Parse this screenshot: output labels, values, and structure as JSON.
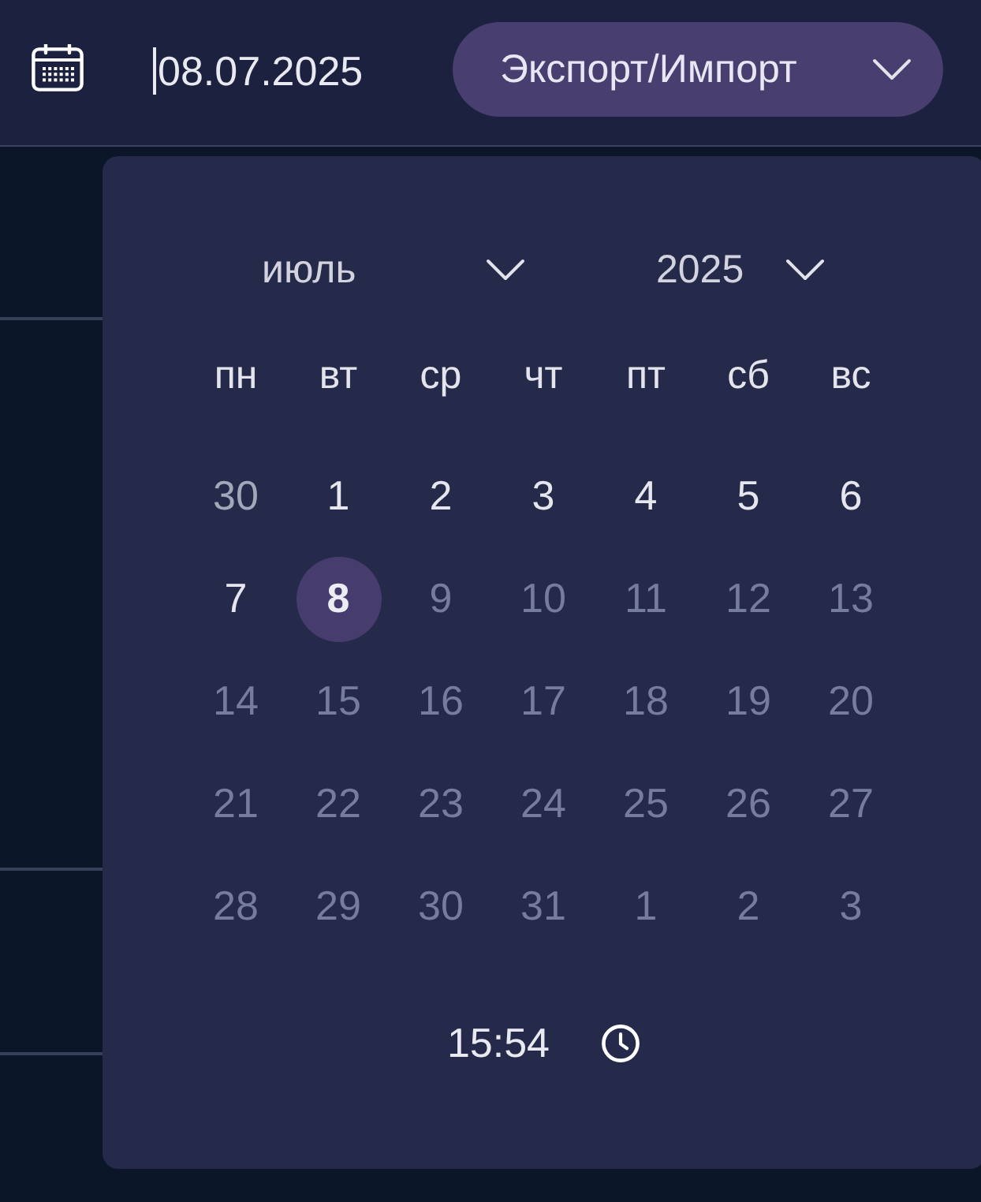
{
  "toolbar": {
    "date_field": {
      "value": "08.07.2025",
      "focused": true
    },
    "export_button": {
      "label": "Экспорт/Импорт"
    }
  },
  "date_picker": {
    "month": "июль",
    "year": "2025",
    "weekdays": [
      "пн",
      "вт",
      "ср",
      "чт",
      "пт",
      "сб",
      "вс"
    ],
    "weeks": [
      {
        "days": [
          {
            "label": "30",
            "kind": "outside",
            "selected": false
          },
          {
            "label": "1",
            "kind": "current",
            "selected": false
          },
          {
            "label": "2",
            "kind": "current",
            "selected": false
          },
          {
            "label": "3",
            "kind": "current",
            "selected": false
          },
          {
            "label": "4",
            "kind": "current",
            "selected": false
          },
          {
            "label": "5",
            "kind": "current",
            "selected": false
          },
          {
            "label": "6",
            "kind": "current",
            "selected": false
          }
        ]
      },
      {
        "days": [
          {
            "label": "7",
            "kind": "current",
            "selected": false
          },
          {
            "label": "8",
            "kind": "current",
            "selected": true
          },
          {
            "label": "9",
            "kind": "disabled",
            "selected": false
          },
          {
            "label": "10",
            "kind": "disabled",
            "selected": false
          },
          {
            "label": "11",
            "kind": "disabled",
            "selected": false
          },
          {
            "label": "12",
            "kind": "disabled",
            "selected": false
          },
          {
            "label": "13",
            "kind": "disabled",
            "selected": false
          }
        ]
      },
      {
        "days": [
          {
            "label": "14",
            "kind": "disabled",
            "selected": false
          },
          {
            "label": "15",
            "kind": "disabled",
            "selected": false
          },
          {
            "label": "16",
            "kind": "disabled",
            "selected": false
          },
          {
            "label": "17",
            "kind": "disabled",
            "selected": false
          },
          {
            "label": "18",
            "kind": "disabled",
            "selected": false
          },
          {
            "label": "19",
            "kind": "disabled",
            "selected": false
          },
          {
            "label": "20",
            "kind": "disabled",
            "selected": false
          }
        ]
      },
      {
        "days": [
          {
            "label": "21",
            "kind": "disabled",
            "selected": false
          },
          {
            "label": "22",
            "kind": "disabled",
            "selected": false
          },
          {
            "label": "23",
            "kind": "disabled",
            "selected": false
          },
          {
            "label": "24",
            "kind": "disabled",
            "selected": false
          },
          {
            "label": "25",
            "kind": "disabled",
            "selected": false
          },
          {
            "label": "26",
            "kind": "disabled",
            "selected": false
          },
          {
            "label": "27",
            "kind": "disabled",
            "selected": false
          }
        ]
      },
      {
        "days": [
          {
            "label": "28",
            "kind": "disabled",
            "selected": false
          },
          {
            "label": "29",
            "kind": "disabled",
            "selected": false
          },
          {
            "label": "30",
            "kind": "disabled",
            "selected": false
          },
          {
            "label": "31",
            "kind": "disabled",
            "selected": false
          },
          {
            "label": "1",
            "kind": "disabled",
            "selected": false
          },
          {
            "label": "2",
            "kind": "disabled",
            "selected": false
          },
          {
            "label": "3",
            "kind": "disabled",
            "selected": false
          }
        ]
      }
    ],
    "time": "15:54"
  }
}
